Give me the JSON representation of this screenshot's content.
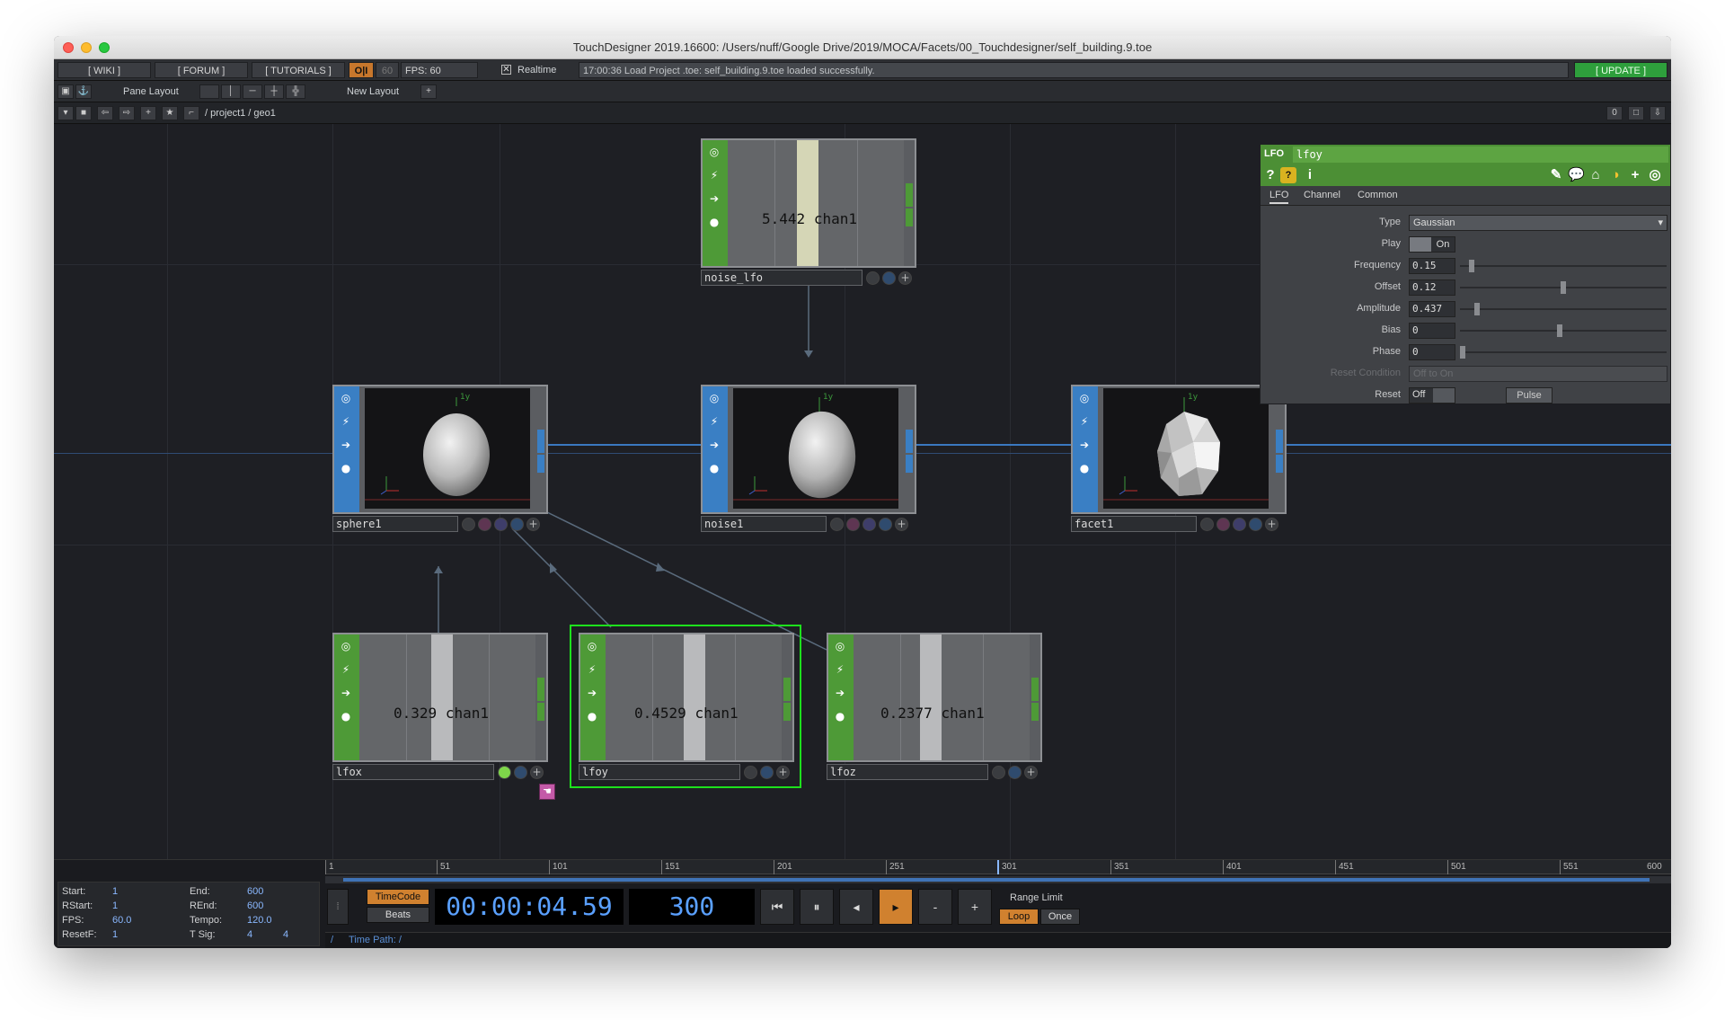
{
  "window": {
    "title": "TouchDesigner 2019.16600: /Users/nuff/Google Drive/2019/MOCA/Facets/00_Touchdesigner/self_building.9.toe"
  },
  "topbar": {
    "wiki": "[ WIKI ]",
    "forum": "[ FORUM ]",
    "tutorials": "[ TUTORIALS ]",
    "oi": "O|I",
    "sixty": "60",
    "fps": "FPS:  60",
    "realtime_check": "✕",
    "realtime": "Realtime",
    "status": "17:00:36 Load Project .toe:  self_building.9.toe loaded successfully.",
    "update": "[ UPDATE ]"
  },
  "toolbar2": {
    "pane_layout": "Pane Layout",
    "new_layout": "New Layout",
    "add": "+"
  },
  "toolbar3": {
    "breadcrumb": "/ project1 / geo1",
    "counter": "0"
  },
  "nodes": {
    "noise_lfo": {
      "name": "noise_lfo",
      "value": "5.442",
      "channel": "chan1",
      "level": 0.28
    },
    "sphere1": {
      "name": "sphere1",
      "axis": "1y"
    },
    "noise1": {
      "name": "noise1",
      "axis": "1y"
    },
    "facet1": {
      "name": "facet1",
      "axis": "1y"
    },
    "lfox": {
      "name": "lfox",
      "value": "0.329",
      "channel": "chan1",
      "level": 0.33
    },
    "lfoy": {
      "name": "lfoy",
      "value": "0.4529",
      "channel": "chan1",
      "level": 0.45
    },
    "lfoz": {
      "name": "lfoz",
      "value": "0.2377",
      "channel": "chan1",
      "level": 0.24
    }
  },
  "params": {
    "op_type": "LFO",
    "op_name": "lfoy",
    "icons": [
      "help-icon",
      "python-help-icon",
      "info-icon",
      "edit-icon",
      "comment-icon",
      "cook-icon",
      "python-icon",
      "add-icon",
      "target-icon"
    ],
    "tabs": [
      "LFO",
      "Channel",
      "Common"
    ],
    "type_label": "Type",
    "type_value": "Gaussian",
    "play_label": "Play",
    "play_value": "On",
    "frequency_label": "Frequency",
    "frequency_value": "0.15",
    "offset_label": "Offset",
    "offset_value": "0.12",
    "amplitude_label": "Amplitude",
    "amplitude_value": "0.437",
    "bias_label": "Bias",
    "bias_value": "0",
    "phase_label": "Phase",
    "phase_value": "0",
    "reset_condition_label": "Reset Condition",
    "reset_condition_value": "Off to On",
    "reset_label": "Reset",
    "reset_value": "Off",
    "pulse": "Pulse"
  },
  "timeline": {
    "start_label": "Start:",
    "start": "1",
    "end_label": "End:",
    "end": "600",
    "rstart_label": "RStart:",
    "rstart": "1",
    "rend_label": "REnd:",
    "rend": "600",
    "fps_label": "FPS:",
    "fps": "60.0",
    "tempo_label": "Tempo:",
    "tempo": "120.0",
    "resetf_label": "ResetF:",
    "resetf": "1",
    "tsig_label": "T Sig:",
    "tsig_a": "4",
    "tsig_b": "4",
    "ticks": [
      "1",
      "51",
      "101",
      "151",
      "201",
      "251",
      "301",
      "351",
      "401",
      "451",
      "501",
      "551",
      "600"
    ],
    "timecode_btn": "TimeCode",
    "beats_btn": "Beats",
    "timecode": "00:00:04.59",
    "frame": "300",
    "minus": "-",
    "plus": "+",
    "range_limit": "Range Limit",
    "loop": "Loop",
    "once": "Once",
    "time_path": "Time Path: /",
    "slash": "/"
  },
  "colors": {
    "chop_green": "#4e9a37",
    "sop_blue": "#3a7fc4",
    "selected": "#1de01d",
    "accent_orange": "#d0812f"
  }
}
